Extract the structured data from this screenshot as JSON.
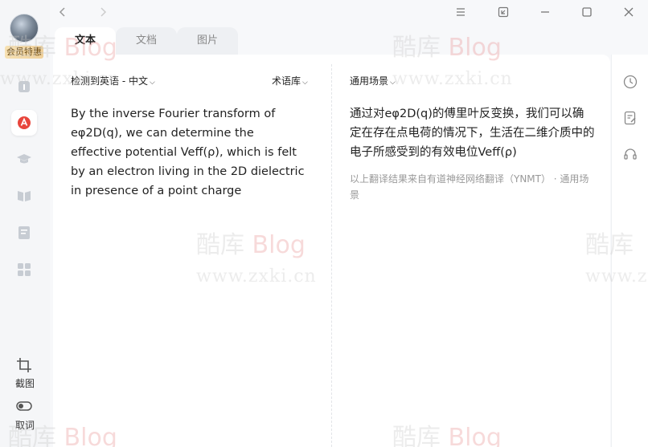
{
  "user": {
    "vip_label": "会员特惠"
  },
  "nav": {
    "back_icon": "chevron-left-icon",
    "forward_icon": "chevron-right-icon"
  },
  "window_controls": [
    "menu-icon",
    "mini-window-icon",
    "minimize-icon",
    "maximize-icon",
    "close-icon"
  ],
  "tabs": [
    {
      "label": "文本",
      "active": true
    },
    {
      "label": "文档",
      "active": false
    },
    {
      "label": "图片",
      "active": false
    }
  ],
  "rail": {
    "icons": [
      "translate-icon",
      "ai-icon",
      "graduation-cap-icon",
      "book-icon",
      "notes-icon",
      "apps-icon"
    ],
    "screenshot_label": "截图",
    "pick_word_label": "取词"
  },
  "source": {
    "lang_select": "检测到英语 - 中文",
    "term_select": "术语库",
    "text": "By the inverse Fourier transform of eφ2D(q), we can determine the effective potential Veff(ρ), which is felt by an electron living in the 2D dielectric in presence of a point charge"
  },
  "target": {
    "scene_select": "通用场景",
    "text": "通过对eφ2D(q)的傅里叶反变换，我们可以确定在存在点电荷的情况下，生活在二维介质中的电子所感受到的有效电位Veff(ρ)",
    "meta": "以上翻译结果来自有道神经网络翻译（YNMT） · 通用场景"
  },
  "right_rail_icons": [
    "history-icon",
    "edit-note-icon",
    "headset-icon"
  ],
  "watermark": {
    "brand_cn": "酷库",
    "brand_en": "Blog",
    "url": "www.zxki.cn"
  },
  "colors": {
    "accent": "#e8453c",
    "text": "#222222",
    "muted": "#999999"
  }
}
